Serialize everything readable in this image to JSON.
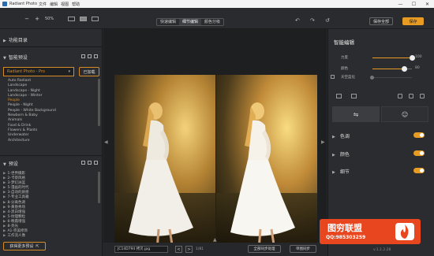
{
  "app": {
    "title": "Radiant Photo",
    "menu": [
      "文件",
      "编辑",
      "视图",
      "帮助"
    ]
  },
  "window_controls": [
    "—",
    "☐",
    "✕"
  ],
  "toolbar": {
    "zoom_out": "−",
    "zoom_in": "+",
    "zoom": "50%",
    "modes": [
      "快速编辑",
      "细节编辑",
      "颜色分级"
    ],
    "active_mode": 1,
    "undo": "↶",
    "redo": "↷",
    "reset": "↺",
    "save_label": "保存全部",
    "export_label": "保存"
  },
  "left_panel": {
    "function_list": "功能目录",
    "smart_presets": "智能预设",
    "preset_selected": "Radiant Photo - Pro",
    "open_button": "已加载",
    "presets": [
      "Auto Radiant",
      "Landscape",
      "Landscape - Night",
      "Landscape - Winter",
      "People",
      "People - Night",
      "People - White Background",
      "Newborn & Baby",
      "Animals",
      "Food & Drink",
      "Flowers & Plants",
      "Underwater",
      "Architecture"
    ],
    "selected_preset": "People",
    "filters_title": "预设",
    "filters": [
      "1-世界摄影",
      "2-卡萘风格",
      "3-梦幻洲蓝",
      "5-漫画的时代",
      "3-自动的质感",
      "7-专业工具箱",
      "8-分离色调",
      "9-黄昏秀场",
      "4-黑白增强",
      "5-纹理颗粒",
      "6-晚霞增强",
      "8-亮光",
      "A1-完美修饰",
      "工作流人像"
    ],
    "bottom_button": "获得更多预设"
  },
  "center": {
    "filename": "JC14D794 拷贝.jpg",
    "prev": "<",
    "next": ">",
    "page": "1/81",
    "sync_label": "全部同步处理",
    "compare_label": "单图同步"
  },
  "right_panel": {
    "title": "智能编辑",
    "sliders": [
      {
        "label": "力度",
        "value": 100
      },
      {
        "label": "颜色",
        "value": 80
      },
      {
        "label": "天空蓝化",
        "value": 0
      }
    ],
    "sections": [
      "色调",
      "颜色",
      "细节"
    ],
    "version": "v.1.1.2.28"
  },
  "watermark": {
    "line1": "图穷联盟",
    "line2": "QQ:985303259"
  }
}
